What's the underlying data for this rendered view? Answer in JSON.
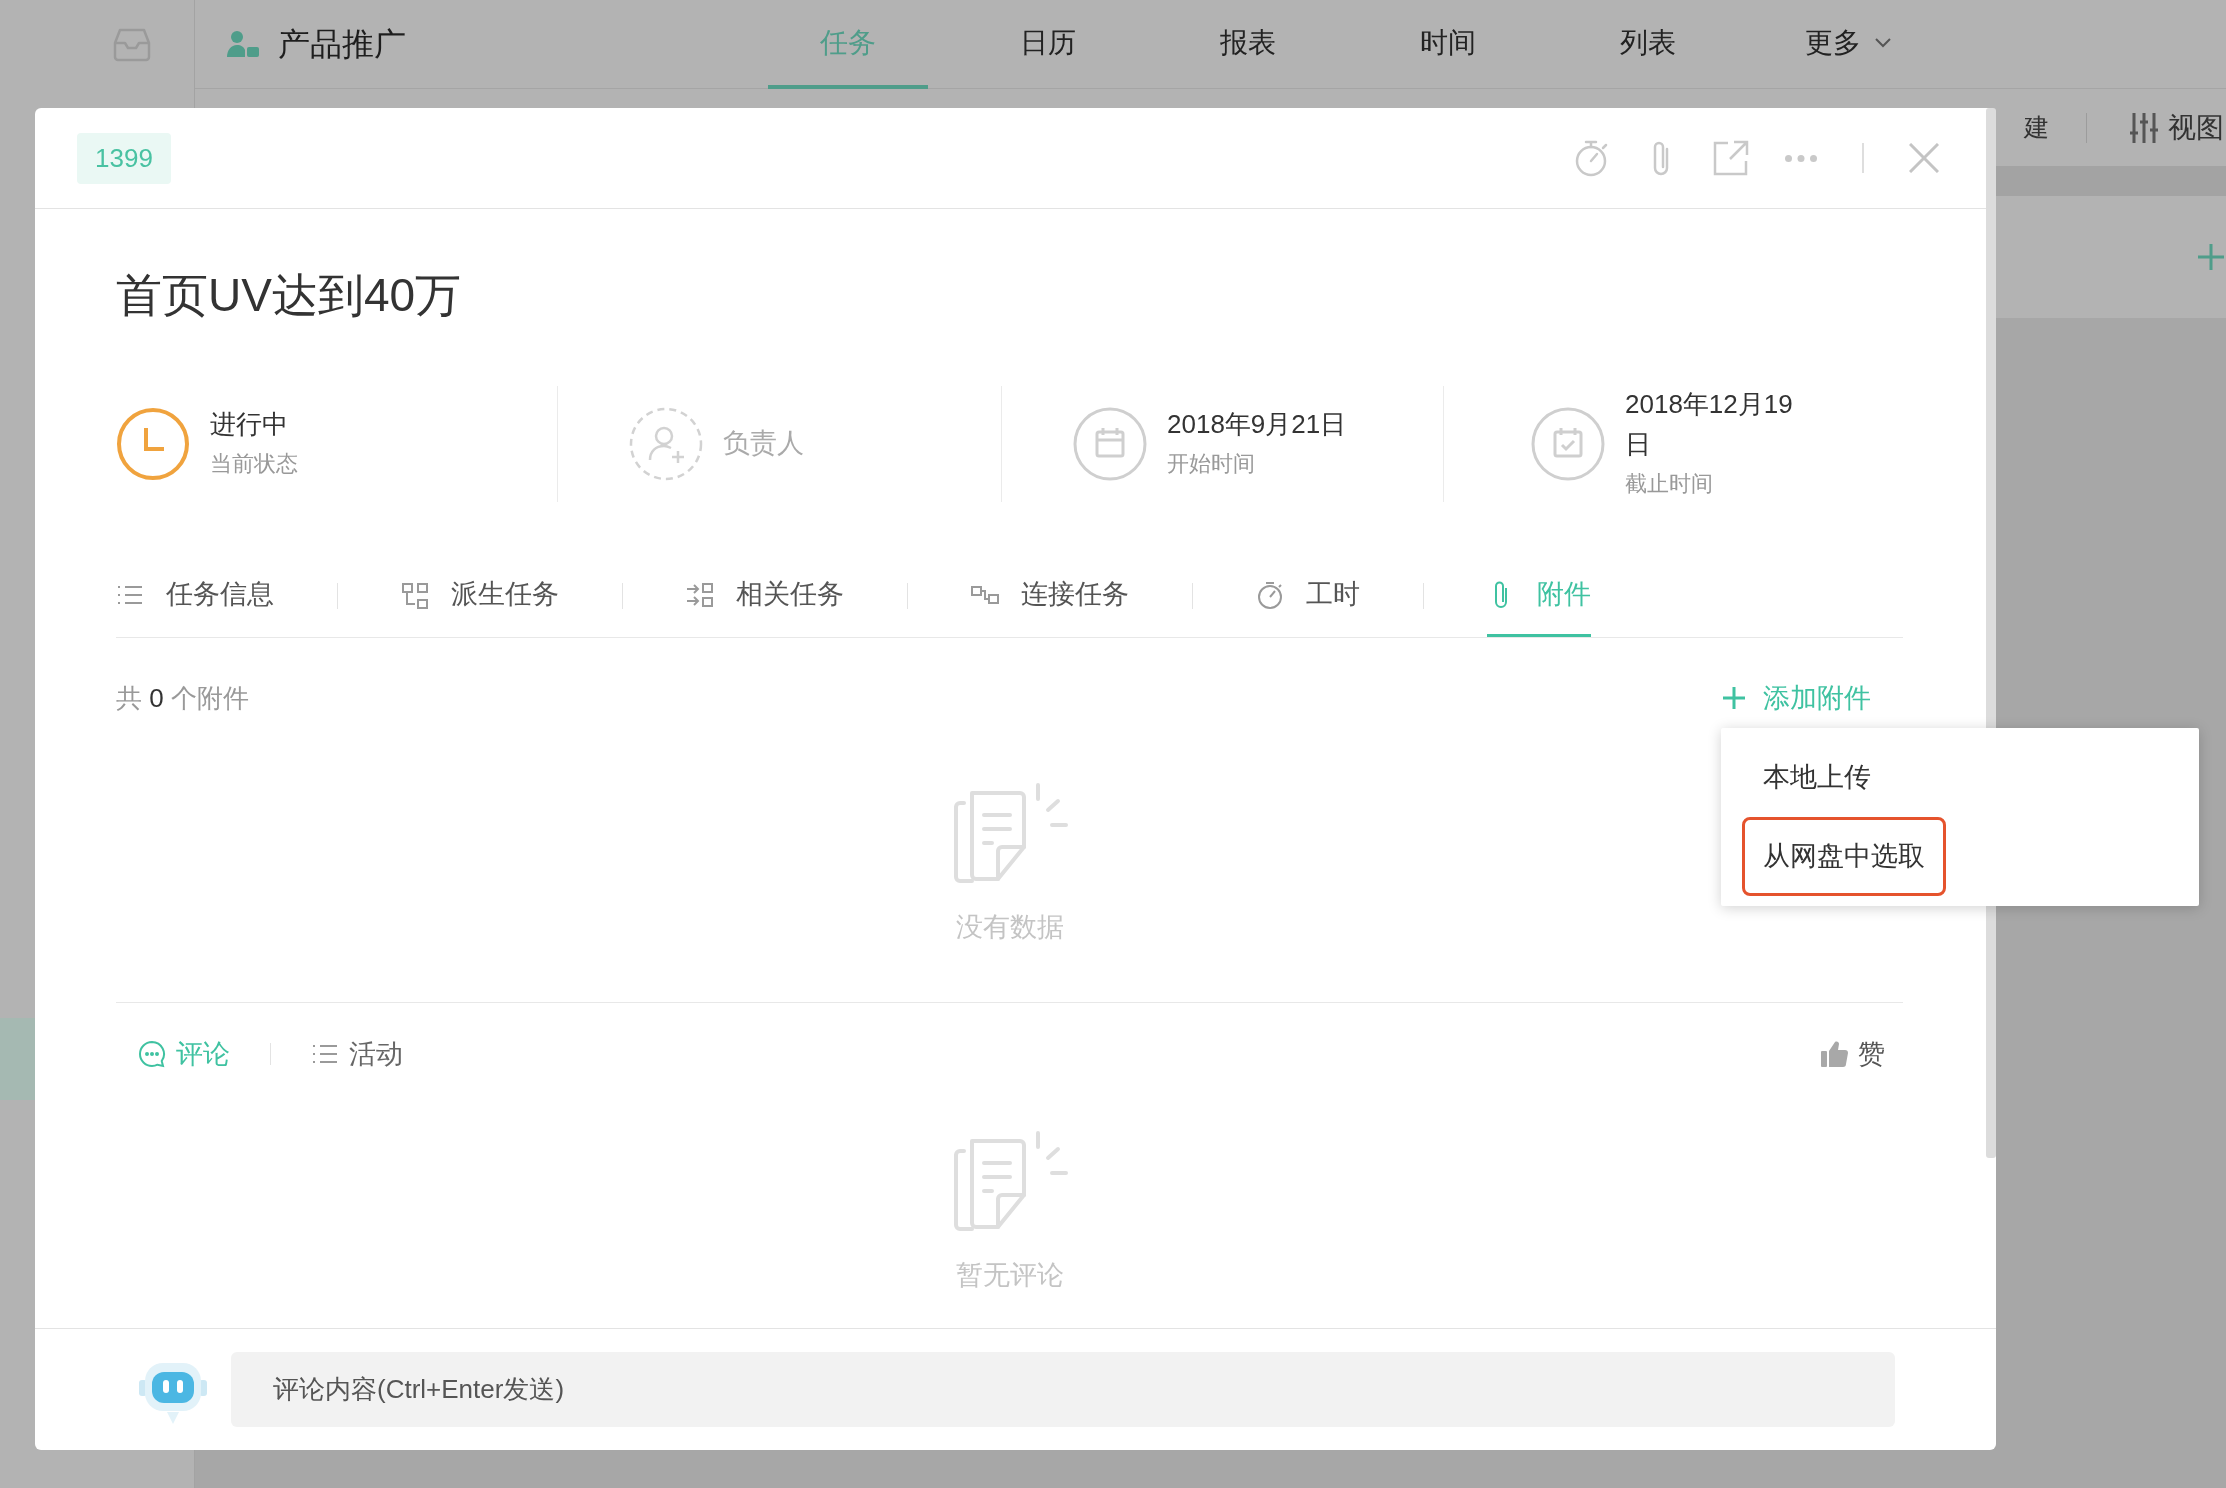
{
  "app": {
    "project": {
      "title": "产品推广"
    },
    "nav_tabs": [
      {
        "label": "任务",
        "selected": true,
        "kind": "view"
      },
      {
        "label": "日历",
        "selected": false,
        "kind": "view"
      },
      {
        "label": "报表",
        "selected": false,
        "kind": "view"
      },
      {
        "label": "时间",
        "selected": false,
        "kind": "view"
      },
      {
        "label": "列表",
        "selected": false,
        "kind": "view"
      },
      {
        "label": "更多",
        "selected": false,
        "kind": "menu"
      }
    ],
    "toolbar": [
      {
        "label": "建"
      },
      {
        "label": "视图"
      }
    ]
  },
  "task_dialog": {
    "id_badge": "1399",
    "title": "首页UV达到40万",
    "fields": [
      {
        "kind": "status",
        "value": "进行中",
        "caption": "当前状态"
      },
      {
        "kind": "assignee",
        "placeholder": "负责人"
      },
      {
        "kind": "start_date",
        "value": "2018年9月21日",
        "caption": "开始时间"
      },
      {
        "kind": "due_date",
        "value": "2018年12月19日",
        "caption": "截止时间"
      }
    ],
    "tabs": [
      {
        "label": "任务信息",
        "selected": false
      },
      {
        "label": "派生任务",
        "selected": false
      },
      {
        "label": "相关任务",
        "selected": false
      },
      {
        "label": "连接任务",
        "selected": false
      },
      {
        "label": "工时",
        "selected": false
      },
      {
        "label": "附件",
        "selected": true
      }
    ],
    "attachments": {
      "count_prefix": "共",
      "count": "0",
      "count_suffix": "个附件",
      "add_button": "添加附件",
      "empty_text": "没有数据"
    },
    "add_menu": [
      {
        "label": "本地上传",
        "highlighted": false
      },
      {
        "label": "从网盘中选取",
        "highlighted": true
      }
    ],
    "activity_tabs": [
      {
        "label": "评论",
        "selected": true
      },
      {
        "label": "活动",
        "selected": false
      }
    ],
    "like_button": "赞",
    "comments_empty_text": "暂无评论",
    "comment_input": {
      "placeholder": "评论内容(Ctrl+Enter发送)"
    }
  }
}
